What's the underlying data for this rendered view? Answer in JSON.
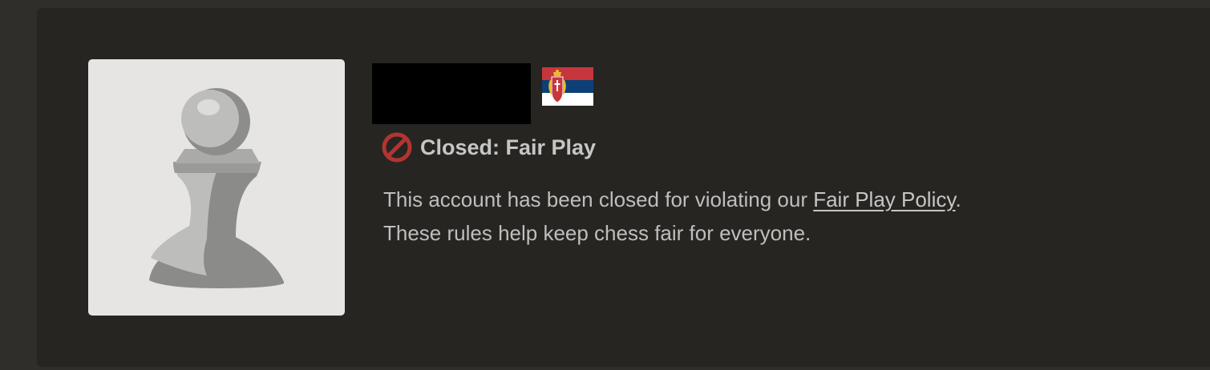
{
  "profile": {
    "country_flag": "serbia-flag",
    "flag_colors": {
      "top": "#c6363c",
      "middle": "#0c4076",
      "bottom": "#ffffff"
    },
    "avatar_icon": "pawn-icon",
    "avatar_bg": "#e6e5e3"
  },
  "status": {
    "icon": "prohibited-icon",
    "icon_color": "#b33430",
    "label": "Closed: Fair Play"
  },
  "message": {
    "line1_prefix": "This account has been closed for violating our ",
    "policy_link": "Fair Play Policy",
    "line1_suffix": ".",
    "line2": "These rules help keep chess fair for everyone."
  }
}
